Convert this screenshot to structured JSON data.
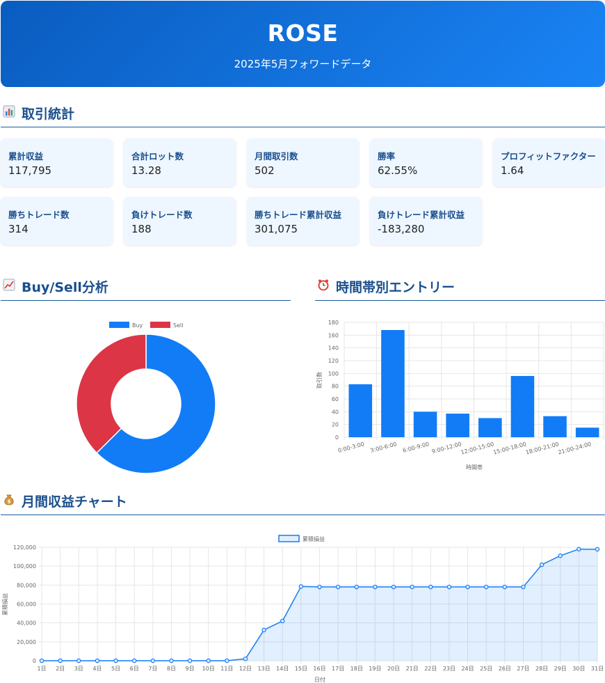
{
  "header": {
    "title": "ROSE",
    "subtitle": "2025年5月フォワードデータ"
  },
  "sections": {
    "stats": {
      "icon": "bar-chart-icon",
      "title": "取引統計"
    },
    "buysell": {
      "icon": "trend-up-icon",
      "title": "Buy/Sell分析"
    },
    "hourly": {
      "icon": "alarm-clock-icon",
      "title": "時間帯別エントリー"
    },
    "monthly": {
      "icon": "money-bag-icon",
      "title": "月間収益チャート"
    }
  },
  "stats": [
    {
      "label": "累計収益",
      "value": "117,795"
    },
    {
      "label": "合計ロット数",
      "value": "13.28"
    },
    {
      "label": "月間取引数",
      "value": "502"
    },
    {
      "label": "勝率",
      "value": "62.55%"
    },
    {
      "label": "プロフィットファクター",
      "value": "1.64"
    },
    {
      "label": "勝ちトレード数",
      "value": "314"
    },
    {
      "label": "負けトレード数",
      "value": "188"
    },
    {
      "label": "勝ちトレード累計収益",
      "value": "301,075"
    },
    {
      "label": "負けトレード累計収益",
      "value": "-183,280"
    }
  ],
  "colors": {
    "buy": "#127cf7",
    "sell": "#dc3545",
    "header_start": "#0a5cbf",
    "header_end": "#1a84f5",
    "accent": "#1a4f8c"
  },
  "chart_data": [
    {
      "type": "pie",
      "variant": "doughnut",
      "labels": [
        "Buy",
        "Sell"
      ],
      "values": [
        314,
        188
      ],
      "legend": "top"
    },
    {
      "type": "bar",
      "categories": [
        "0:00-3:00",
        "3:00-6:00",
        "6:00-9:00",
        "9:00-12:00",
        "12:00-15:00",
        "15:00-18:00",
        "18:00-21:00",
        "21:00-24:00"
      ],
      "values": [
        83,
        168,
        40,
        37,
        30,
        96,
        33,
        15
      ],
      "xlabel": "時間帯",
      "ylabel": "取引数",
      "ylim": [
        0,
        180
      ],
      "yticks": [
        0,
        20,
        40,
        60,
        80,
        100,
        120,
        140,
        160,
        180
      ],
      "grid": true
    },
    {
      "type": "area",
      "series": [
        {
          "name": "累積損益",
          "values": [
            0,
            0,
            0,
            0,
            0,
            0,
            0,
            0,
            0,
            0,
            0,
            2000,
            32500,
            42000,
            78500,
            78000,
            78000,
            78000,
            78000,
            78000,
            78000,
            78000,
            78000,
            78000,
            78000,
            78000,
            78000,
            101500,
            111000,
            118000,
            117795
          ]
        }
      ],
      "x": [
        "1日",
        "2日",
        "3日",
        "4日",
        "5日",
        "6日",
        "7日",
        "8日",
        "9日",
        "10日",
        "11日",
        "12日",
        "13日",
        "14日",
        "15日",
        "16日",
        "17日",
        "18日",
        "19日",
        "20日",
        "21日",
        "22日",
        "23日",
        "24日",
        "25日",
        "26日",
        "27日",
        "28日",
        "29日",
        "30日",
        "31日"
      ],
      "xlabel": "日付",
      "ylabel": "累積損益",
      "ylim": [
        0,
        120000
      ],
      "yticks": [
        "0",
        "20,000",
        "40,000",
        "60,000",
        "80,000",
        "100,000",
        "120,000"
      ],
      "grid": true,
      "legend": "top"
    }
  ]
}
